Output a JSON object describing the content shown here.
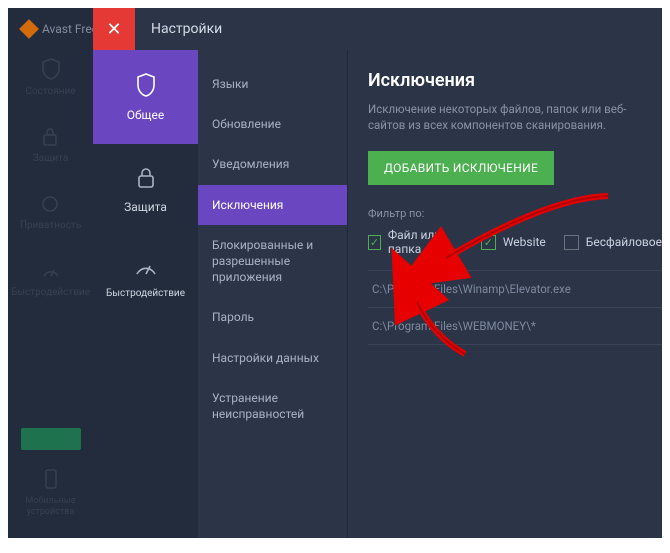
{
  "app_name": "Avast Free A",
  "bgnav": {
    "items": [
      "Состояние",
      "Защита",
      "Приватность",
      "Быстродействие"
    ],
    "bottom_label": "Мобильные устройства"
  },
  "modal": {
    "title": "Настройки",
    "close_glyph": "✕"
  },
  "col1": [
    {
      "label": "Общее",
      "icon": "shield"
    },
    {
      "label": "Защита",
      "icon": "lock"
    },
    {
      "label": "Быстродействие",
      "icon": "gauge"
    }
  ],
  "col2": [
    "Языки",
    "Обновление",
    "Уведомления",
    "Исключения",
    "Блокированные и разрешенные приложения",
    "Пароль",
    "Настройки данных",
    "Устранение неисправностей"
  ],
  "content": {
    "heading": "Исключения",
    "sub": "Исключение некоторых файлов, папок или веб-сайтов из всех компонентов сканирования.",
    "add_button": "ДОБАВИТЬ ИСКЛЮЧЕНИЕ",
    "filter_label": "Фильтр по:",
    "filters": [
      {
        "label": "Файл или папка",
        "checked": true
      },
      {
        "label": "Website",
        "checked": true
      },
      {
        "label": "Бесфайловое",
        "checked": false
      }
    ],
    "exclusions": [
      "C:\\Program Files\\Winamp\\Elevator.exe",
      "C:\\Program Files\\WEBMONEY\\*"
    ]
  }
}
